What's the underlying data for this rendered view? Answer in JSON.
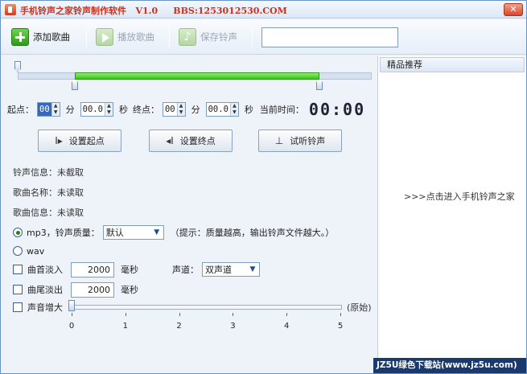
{
  "window": {
    "title": "手机铃声之家铃声制作软件   V1.0     BBS:1253012530.COM",
    "close_glyph": "✕"
  },
  "toolbar": {
    "add": "添加歌曲",
    "play": "播放歌曲",
    "save": "保存铃声",
    "search_value": ""
  },
  "time": {
    "start_label": "起点：",
    "start_min": "00",
    "min_unit": "分",
    "start_sec": "00.0",
    "sec_unit": "秒",
    "end_label": "终点：",
    "end_min": "00",
    "end_sec": "00.0",
    "current_label": "当前时间：",
    "current_value": "00:00"
  },
  "buttons": {
    "set_start": "设置起点",
    "set_end": "设置终点",
    "preview": "试听铃声"
  },
  "info": {
    "ringtone": "铃声信息：未截取",
    "song_name": "歌曲名称：未读取",
    "song_info": "歌曲信息：未读取"
  },
  "format": {
    "mp3_label": "mp3，铃声质量：",
    "quality": "默认",
    "hint": "（提示：质量越高，输出铃声文件越大。）",
    "wav_label": "wav"
  },
  "effects": {
    "fade_in_label": "曲首淡入",
    "fade_in_value": "2000",
    "ms_unit": "毫秒",
    "channel_label": "声道：",
    "channel_value": "双声道",
    "fade_out_label": "曲尾淡出",
    "fade_out_value": "2000",
    "volume_label": "声音增大",
    "volume_original": "(原始)",
    "volume_ticks": [
      "0",
      "1",
      "2",
      "3",
      "4",
      "5"
    ],
    "volume_level": 0
  },
  "sidebar": {
    "header": "精品推荐",
    "link": ">>>点击进入手机铃声之家"
  },
  "watermark": "JZ5U绿色下载站(www.jz5u.com)"
}
